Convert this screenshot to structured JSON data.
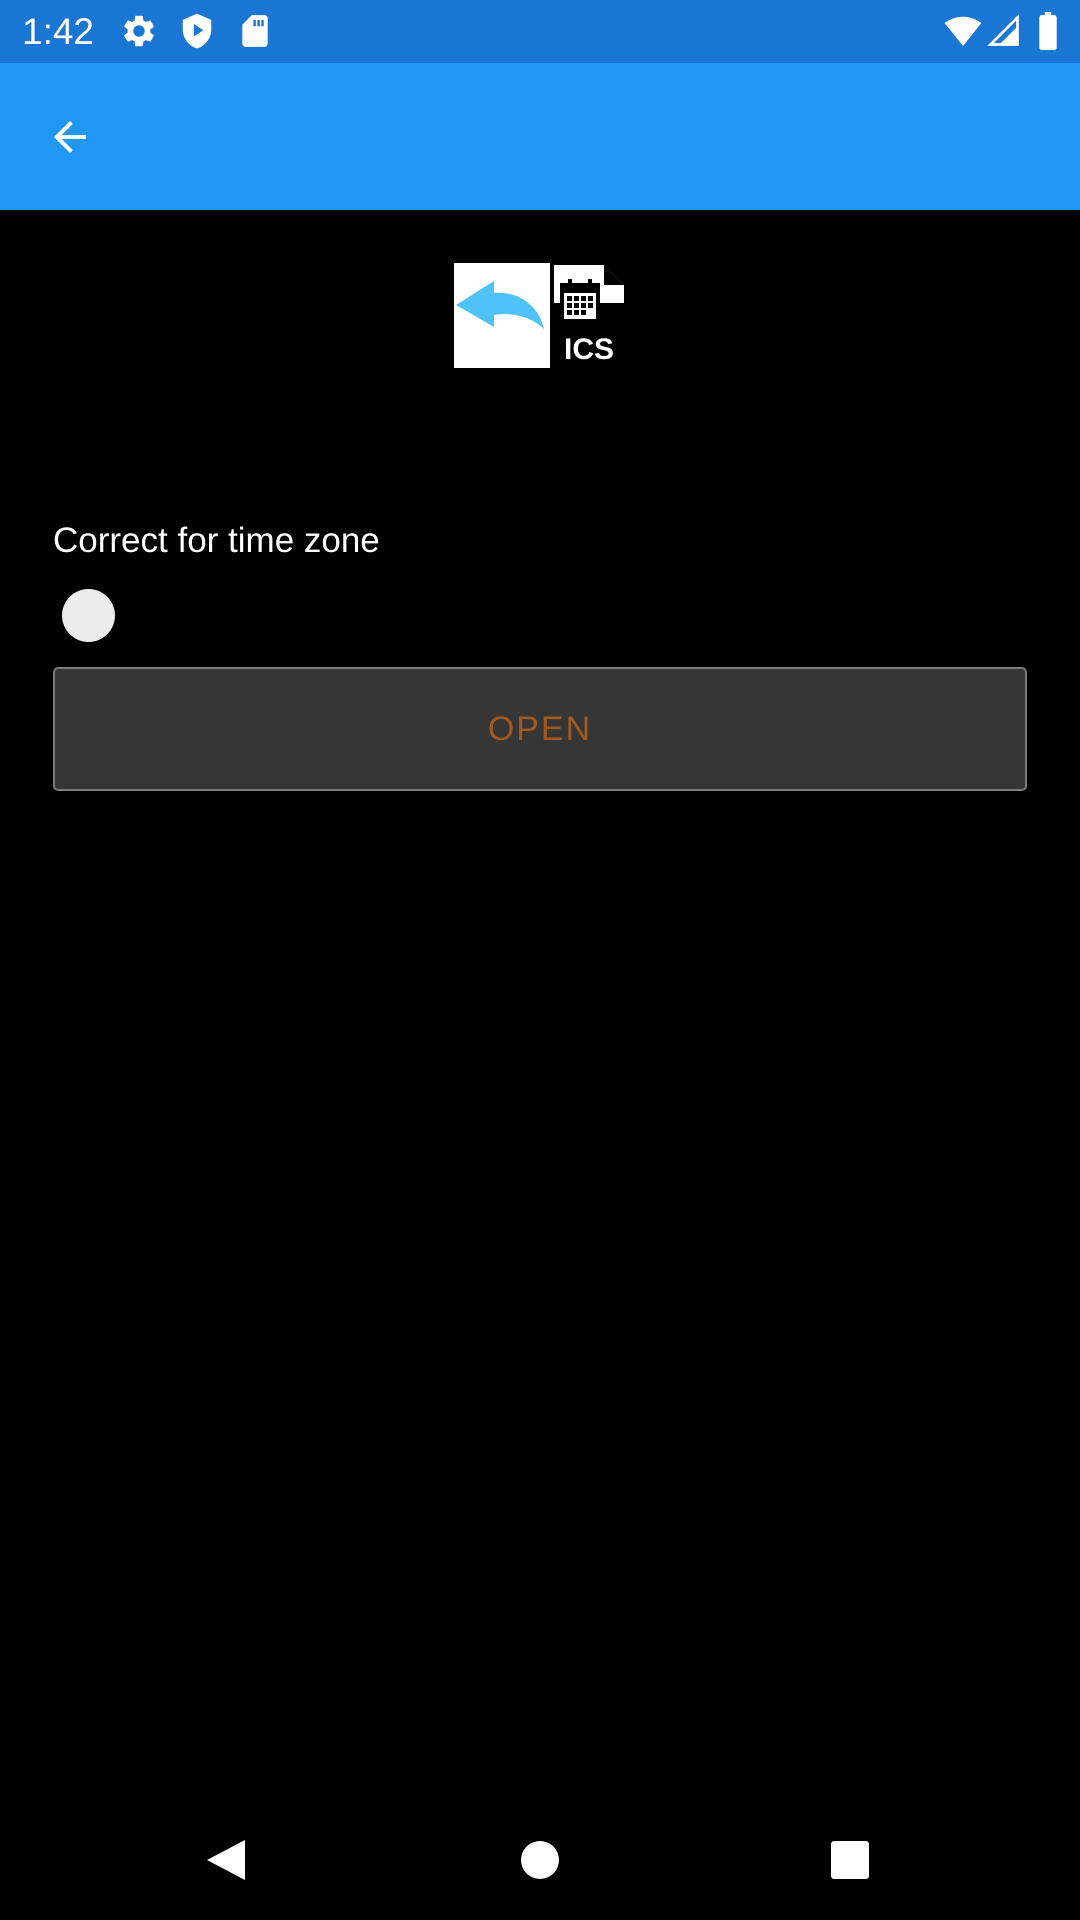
{
  "status_bar": {
    "time": "1:42",
    "background": "#1976D2",
    "icons": [
      "gear-icon",
      "shield-play-icon",
      "sd-card-icon",
      "wifi-icon",
      "cell-signal-icon",
      "battery-icon"
    ]
  },
  "app_bar": {
    "background": "#2196F3",
    "back_icon": "arrow-left-icon"
  },
  "logo": {
    "icon": "ics-import-logo",
    "text": "ICS"
  },
  "settings": {
    "timezone_label": "Correct for time zone",
    "timezone_enabled": false
  },
  "actions": {
    "open_label": "OPEN",
    "open_color": "#A0581E"
  },
  "nav_bar": {
    "icons": [
      "back-triangle-icon",
      "home-circle-icon",
      "recents-square-icon"
    ]
  }
}
